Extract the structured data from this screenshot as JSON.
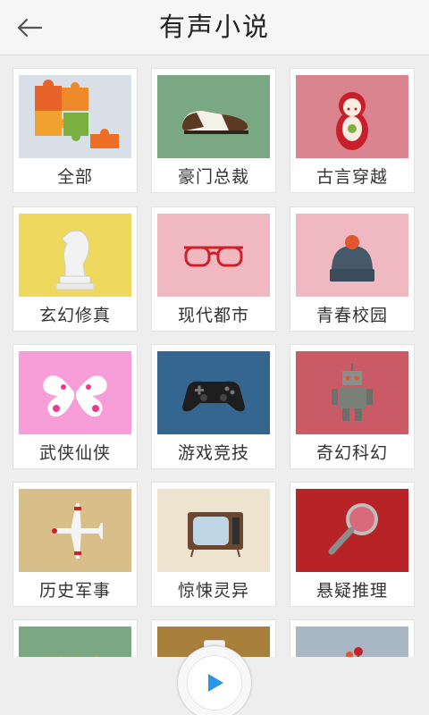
{
  "header": {
    "title": "有声小说",
    "back_icon": "back-arrow-icon"
  },
  "categories": [
    {
      "label": "全部",
      "icon": "puzzle-icon",
      "bg": "#d9dfe6"
    },
    {
      "label": "豪门总裁",
      "icon": "shoe-icon",
      "bg": "#7aa882"
    },
    {
      "label": "古言穿越",
      "icon": "matryoshka-icon",
      "bg": "#d9848f"
    },
    {
      "label": "玄幻修真",
      "icon": "chess-knight-icon",
      "bg": "#efd85e"
    },
    {
      "label": "现代都市",
      "icon": "glasses-icon",
      "bg": "#f0b8c0"
    },
    {
      "label": "青春校园",
      "icon": "beanie-icon",
      "bg": "#f0b8c0"
    },
    {
      "label": "武侠仙侠",
      "icon": "butterfly-icon",
      "bg": "#f79ed8"
    },
    {
      "label": "游戏竞技",
      "icon": "gamepad-icon",
      "bg": "#356690"
    },
    {
      "label": "奇幻科幻",
      "icon": "robot-icon",
      "bg": "#c95a66"
    },
    {
      "label": "历史军事",
      "icon": "airplane-icon",
      "bg": "#d8bf8a"
    },
    {
      "label": "惊悚灵异",
      "icon": "tv-icon",
      "bg": "#ede3cf"
    },
    {
      "label": "悬疑推理",
      "icon": "magnifier-icon",
      "bg": "#b82328"
    },
    {
      "label": "",
      "icon": "partial-thumb-icon",
      "bg": "#7aa882"
    },
    {
      "label": "",
      "icon": "partial-thumb-icon",
      "bg": "#a8803c"
    },
    {
      "label": "",
      "icon": "flower-icon",
      "bg": "#a9b6c3"
    }
  ],
  "player": {
    "button_icon": "play-icon",
    "accent": "#2a97e6"
  }
}
